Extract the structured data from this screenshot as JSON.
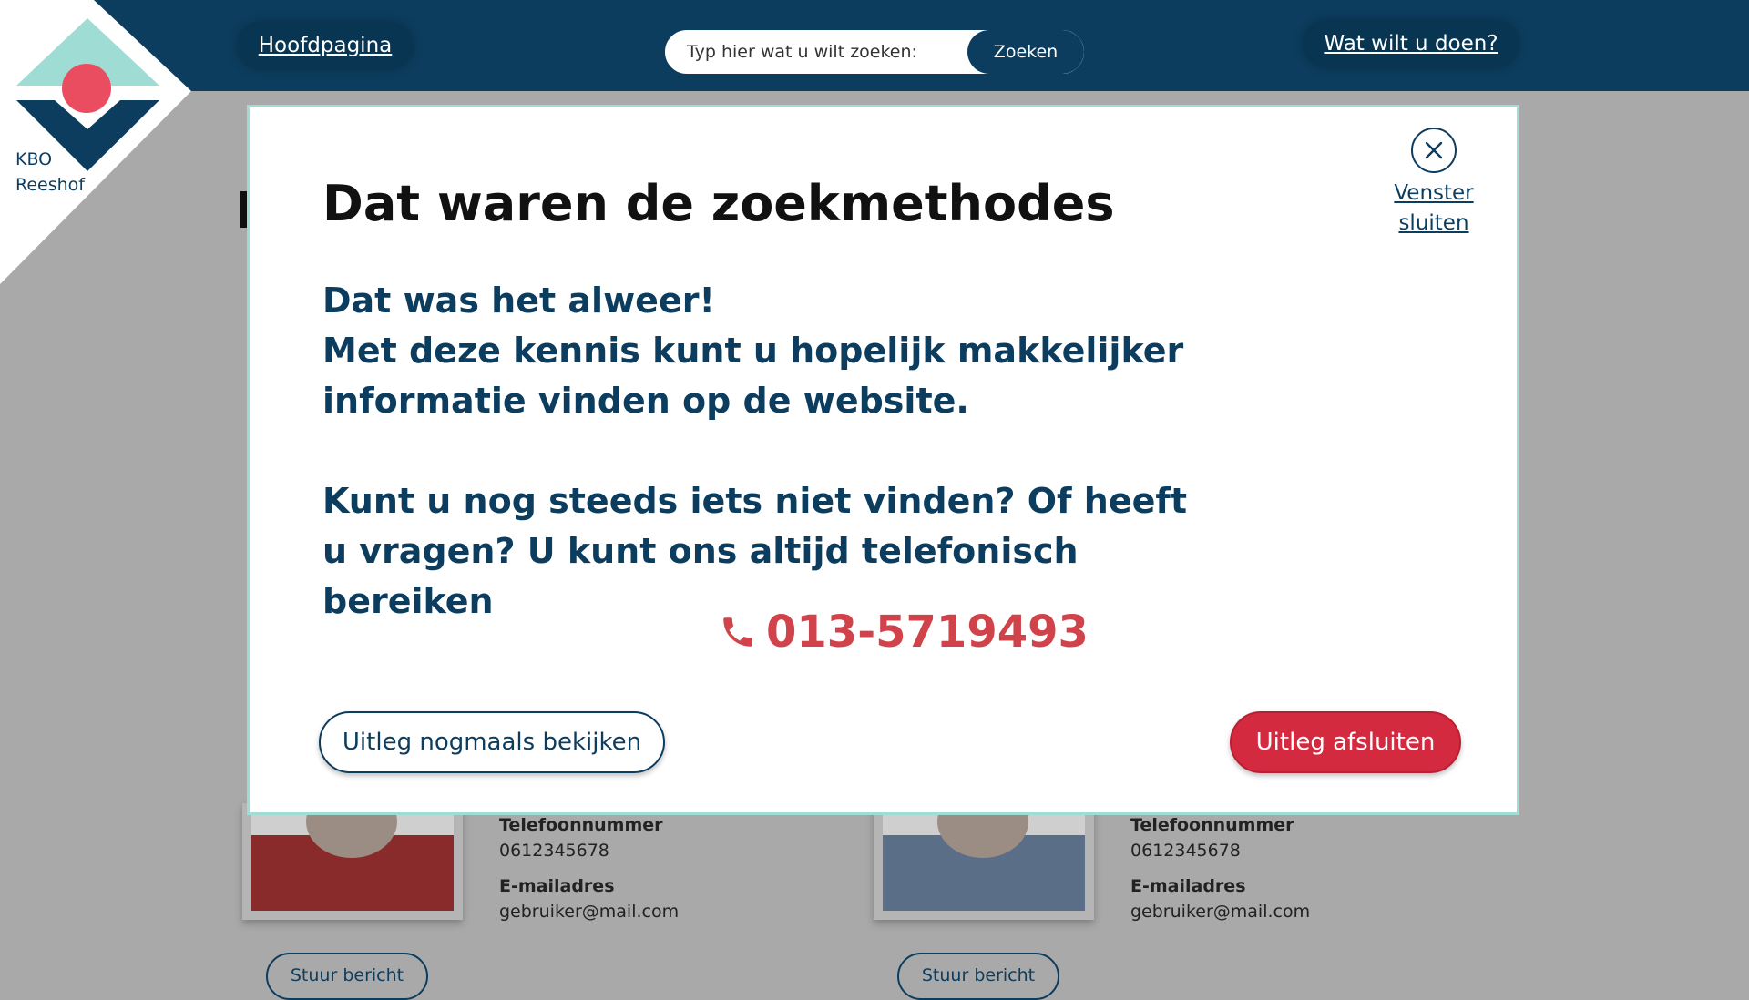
{
  "header": {
    "home_label": "Hoofdpagina",
    "search_placeholder": "Typ hier wat u wilt zoeken:",
    "search_button": "Zoeken",
    "actions_label": "Wat wilt u doen?"
  },
  "logo": {
    "line1": "KBO",
    "line2": "Reeshof"
  },
  "background_cards": [
    {
      "phone_label": "Telefoonnummer",
      "phone": "0612345678",
      "email_label": "E-mailadres",
      "email": "gebruiker@mail.com",
      "button": "Stuur bericht"
    },
    {
      "phone_label": "Telefoonnummer",
      "phone": "0612345678",
      "email_label": "E-mailadres",
      "email": "gebruiker@mail.com",
      "button": "Stuur bericht"
    }
  ],
  "modal": {
    "title": "Dat waren de zoekmethodes",
    "close_line1": "Venster",
    "close_line2": "sluiten",
    "body_line1": "Dat was het alweer!",
    "body_line2": "Met deze kennis kunt u hopelijk makkelijker",
    "body_line3": "informatie vinden op de website.",
    "body_line4": "Kunt u nog steeds iets niet vinden? Of heeft",
    "body_line5": "u vragen? U kunt ons altijd telefonisch bereiken",
    "phone": "013-5719493",
    "button_secondary": "Uitleg nogmaals bekijken",
    "button_primary": "Uitleg afsluiten"
  },
  "colors": {
    "navy": "#0c3d5e",
    "red": "#d42a40",
    "phone_red": "#d0434a",
    "mint": "#9fdcd3",
    "overlay_gray": "#a9a9a9"
  },
  "icons": [
    "close-icon",
    "phone-icon",
    "kbo-logo-icon"
  ]
}
